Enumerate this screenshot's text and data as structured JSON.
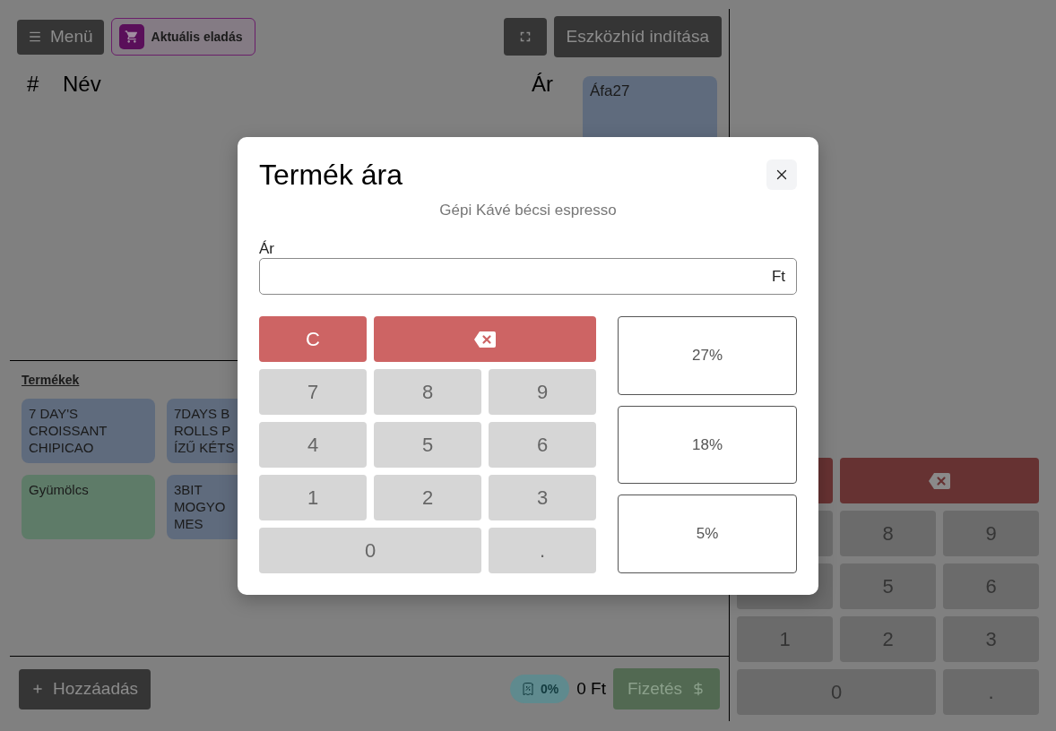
{
  "toolbar": {
    "menu_button": "Menü",
    "current_sale_button": "Aktuális eladás",
    "device_bridge_button": "Eszközhíd indítása"
  },
  "cart_table": {
    "columns": [
      "#",
      "Név",
      "Ár"
    ]
  },
  "vat_groups": [
    {
      "label": "Áfa27"
    }
  ],
  "products": {
    "title": "Termékek",
    "items": [
      {
        "lines": [
          "7 DAY'S",
          "CROISSANT",
          "CHIPICAO"
        ],
        "color": "#5f6b7d"
      },
      {
        "lines": [
          "7DAYS B",
          "ROLLS P",
          "ÍZŰ KÉTS"
        ],
        "color": "#5f6b7d"
      },
      {
        "lines": [
          "Gyümölcs"
        ],
        "color": "#5e7b68"
      },
      {
        "lines": [
          "3BIT",
          "MOGYO",
          "MES"
        ],
        "color": "#5f6b7d"
      }
    ]
  },
  "footer": {
    "add_button": "Hozzáadás",
    "discount_chip": "0%",
    "total": "0 Ft",
    "pay_button": "Fizetés"
  },
  "side_keypad": {
    "keys": [
      {
        "kind": "clear"
      },
      {
        "kind": "backspace"
      },
      {
        "kind": "digit"
      },
      {
        "kind": "digit",
        "label": "8"
      },
      {
        "kind": "digit",
        "label": "9"
      },
      {
        "kind": "digit"
      },
      {
        "kind": "digit",
        "label": "5"
      },
      {
        "kind": "digit",
        "label": "6"
      },
      {
        "kind": "digit",
        "label": "1"
      },
      {
        "kind": "digit",
        "label": "2"
      },
      {
        "kind": "digit",
        "label": "3"
      },
      {
        "kind": "wide",
        "label": "0"
      },
      {
        "kind": "digit",
        "label": "."
      }
    ]
  },
  "dialog": {
    "title": "Termék ára",
    "subtitle": "Gépi Kávé bécsi espresso",
    "price_field": {
      "label": "Ár",
      "suffix": "Ft"
    },
    "keypad": {
      "keys": [
        {
          "kind": "clear",
          "label": "C"
        },
        {
          "kind": "backspace"
        },
        {
          "kind": "digit",
          "label": "7"
        },
        {
          "kind": "digit",
          "label": "8"
        },
        {
          "kind": "digit",
          "label": "9"
        },
        {
          "kind": "digit",
          "label": "4"
        },
        {
          "kind": "digit",
          "label": "5"
        },
        {
          "kind": "digit",
          "label": "6"
        },
        {
          "kind": "digit",
          "label": "1"
        },
        {
          "kind": "digit",
          "label": "2"
        },
        {
          "kind": "digit",
          "label": "3"
        },
        {
          "kind": "wide",
          "label": "0"
        },
        {
          "kind": "digit",
          "label": "."
        }
      ]
    },
    "vat_options": [
      "27%",
      "18%",
      "5%"
    ]
  }
}
